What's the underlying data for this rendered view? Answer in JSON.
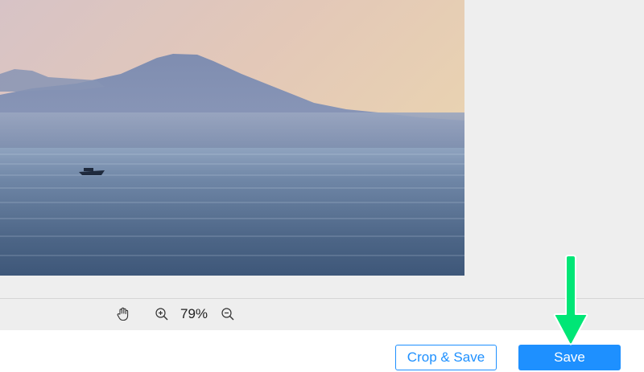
{
  "image": {
    "subject": "volcano-over-sea-with-boat"
  },
  "zoom_bar": {
    "hand_tool_icon": "hand-icon",
    "zoom_in_icon": "zoom-in-icon",
    "zoom_level": "79%",
    "zoom_out_icon": "zoom-out-icon"
  },
  "footer": {
    "crop_save_label": "Crop & Save",
    "save_label": "Save"
  },
  "annotation": {
    "arrow_icon": "down-arrow-icon",
    "arrow_color": "#00e676"
  },
  "colors": {
    "accent": "#1e90ff",
    "canvas_bg": "#eeeeee"
  }
}
